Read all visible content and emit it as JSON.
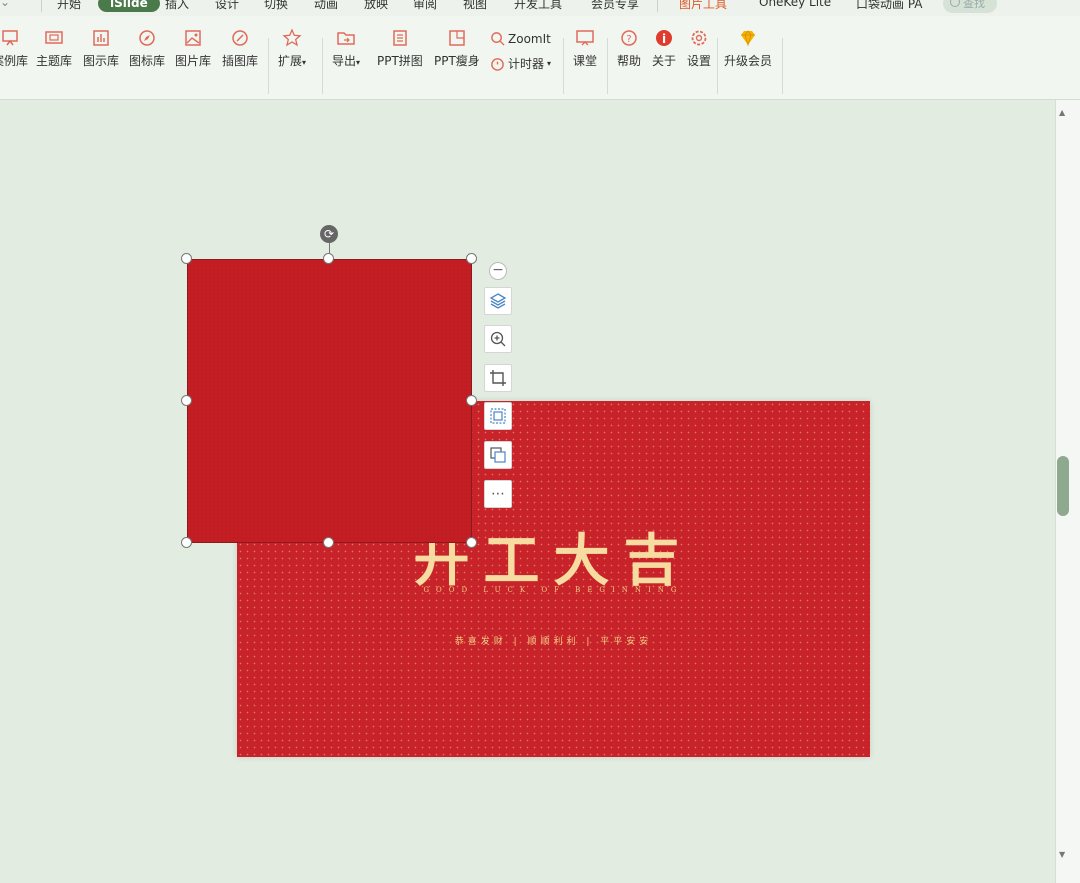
{
  "menubar": {
    "tabs": [
      "开始",
      "iSlide",
      "插入",
      "设计",
      "切换",
      "动画",
      "放映",
      "审阅",
      "视图",
      "开发工具",
      "会员专享",
      "图片工具",
      "OneKey Lite",
      "口袋动画 PA"
    ],
    "active": "iSlide",
    "search_placeholder": "查找"
  },
  "ribbon": {
    "items": [
      "案例库",
      "主题库",
      "图示库",
      "图标库",
      "图片库",
      "插图库",
      "扩展",
      "导出",
      "PPT拼图",
      "PPT瘦身",
      "ZoomIt",
      "计时器",
      "课堂",
      "帮助",
      "关于",
      "设置",
      "升级会员"
    ]
  },
  "slide": {
    "title": "开工大吉",
    "subtitle": "GOOD LUCK OF BEGINNING",
    "wishes": "恭喜发财 | 顺顺利利 | 平平安安"
  },
  "colors": {
    "accent": "#4b7a4a",
    "slide_red": "#c8232a",
    "gold": "#f6dca0",
    "icon_red": "#e06a5a"
  }
}
